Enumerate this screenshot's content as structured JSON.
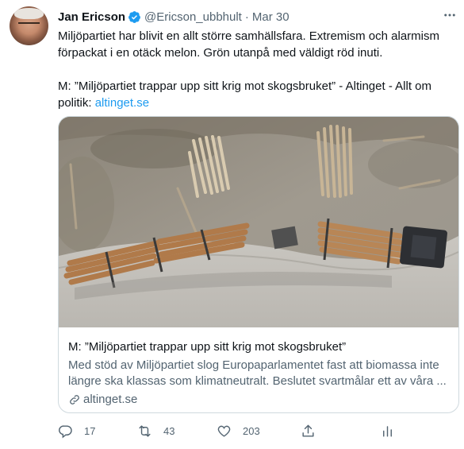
{
  "tweet": {
    "author_name": "Jan Ericson",
    "handle": "@Ericson_ubbhult",
    "separator": "·",
    "date": "Mar 30",
    "text_line1": "Miljöpartiet har blivit en allt större samhällsfara. Extremism och alarmism",
    "text_line2": "förpackat i en otäck melon. Grön utanpå med väldigt röd inuti.",
    "quote_line1": "M: ”Miljöpartiet trappar upp sitt krig mot skogsbruket” - Altinget - Allt om",
    "quote_line2_prefix": "politik: ",
    "quote_link": "altinget.se"
  },
  "card": {
    "title": "M: ”Miljöpartiet trappar upp sitt krig mot skogsbruket”",
    "description": "Med stöd av Miljöpartiet slog Europaparlamentet fast att biomassa inte längre ska klassas som klimatneutralt. Beslutet svartmålar ett av våra ...",
    "domain": "altinget.se",
    "image_subject": "aerial-logging-truck-photo"
  },
  "actions": {
    "replies": "17",
    "retweets": "43",
    "likes": "203"
  },
  "icons": [
    "verified-icon",
    "more-icon",
    "link-icon",
    "reply-icon",
    "retweet-icon",
    "like-icon",
    "share-icon",
    "analytics-icon"
  ],
  "colors": {
    "accent": "#1d9bf0",
    "text": "#0f1419",
    "secondary": "#536471",
    "border": "#cfd9de"
  }
}
